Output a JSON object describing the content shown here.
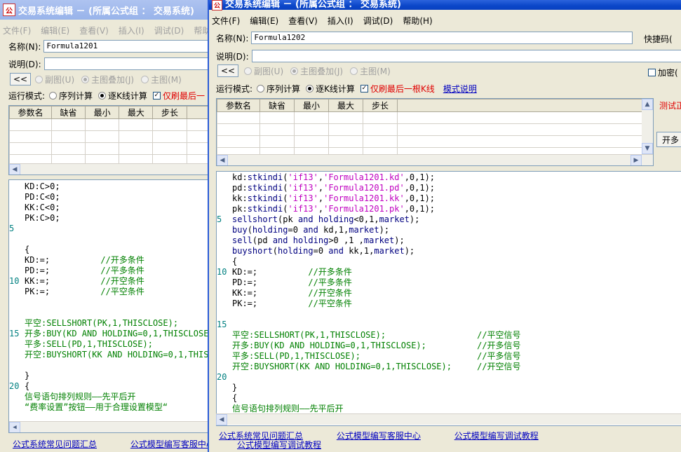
{
  "winA": {
    "title": "交易系统编辑 － (所属公式组 ： 交易系统)",
    "menu": [
      "文件(F)",
      "编辑(E)",
      "查看(V)",
      "插入(I)",
      "调试(D)",
      "帮助"
    ],
    "name_label": "名称(N):",
    "name_value": "Formula1201",
    "desc_label": "说明(D):",
    "desc_value": "",
    "collapse_btn": "<<",
    "chart_opts": [
      "副图(U)",
      "主图叠加(J)",
      "主图(M)"
    ],
    "run_label": "运行模式:",
    "run_seq": "序列计算",
    "run_k": "逐K线计算",
    "refresh_label": "仅刷最后一",
    "param_headers": [
      "参数名",
      "缺省",
      "最小",
      "最大",
      "步长"
    ],
    "code_lines": [
      {
        "n": "",
        "t": "KD:C>0;"
      },
      {
        "n": "",
        "t": "PD:C<0;"
      },
      {
        "n": "",
        "t": "KK:C<0;"
      },
      {
        "n": "",
        "t": "PK:C>0;"
      },
      {
        "n": "5",
        "t": ""
      },
      {
        "n": "",
        "t": ""
      },
      {
        "n": "",
        "t": "{"
      },
      {
        "n": "",
        "t": "KD:=;          //开多条件"
      },
      {
        "n": "",
        "t": "PD:=;          //平多条件"
      },
      {
        "n": "10",
        "t": "KK:=;          //开空条件"
      },
      {
        "n": "",
        "t": "PK:=;          //平空条件"
      },
      {
        "n": "",
        "t": ""
      },
      {
        "n": "",
        "t": ""
      },
      {
        "n": "",
        "t": "平空:SELLSHORT(PK,1,THISCLOSE);"
      },
      {
        "n": "15",
        "t": "开多:BUY(KD AND HOLDING=0,1,THISCLOSE)"
      },
      {
        "n": "",
        "t": "平多:SELL(PD,1,THISCLOSE);"
      },
      {
        "n": "",
        "t": "开空:BUYSHORT(KK AND HOLDING=0,1,THISC"
      },
      {
        "n": "",
        "t": ""
      },
      {
        "n": "",
        "t": "}"
      },
      {
        "n": "20",
        "t": "{"
      },
      {
        "n": "",
        "t": "信号语句排列规则——先平后开"
      },
      {
        "n": "",
        "t": "“费率设置”按钮——用于合理设置模型“"
      }
    ],
    "links": [
      "公式系统常见问题汇总",
      "公式模型编写客服中心"
    ]
  },
  "winB": {
    "title": "交易系统编辑 － (所属公式组 ： 交易系统)",
    "menu": [
      "文件(F)",
      "编辑(E)",
      "查看(V)",
      "插入(I)",
      "调试(D)",
      "帮助(H)"
    ],
    "name_label": "名称(N):",
    "name_value": "Formula1202",
    "shortcut_label": "快捷码(",
    "desc_label": "说明(D):",
    "desc_value": "",
    "collapse_btn": "<<",
    "chart_opts": [
      "副图(U)",
      "主图叠加(J)",
      "主图(M)"
    ],
    "encrypt_label": "加密(",
    "run_label": "运行模式:",
    "run_seq": "序列计算",
    "run_k": "逐K线计算",
    "refresh_label": "仅刷最后一根K线",
    "mode_link": "模式说明",
    "test_label": "测试正",
    "open_btn": "开多",
    "param_headers": [
      "参数名",
      "缺省",
      "最小",
      "最大",
      "步长"
    ],
    "code_lines": [
      {
        "n": "",
        "t": "kd:stkindi('if13','Formula1201.kd',0,1);"
      },
      {
        "n": "",
        "t": "pd:stkindi('if13','Formula1201.pd',0,1);"
      },
      {
        "n": "",
        "t": "kk:stkindi('if13','Formula1201.kk',0,1);"
      },
      {
        "n": "",
        "t": "pk:stkindi('if13','Formula1201.pk',0,1);"
      },
      {
        "n": "5",
        "t": "sellshort(pk and holding<0,1,market);"
      },
      {
        "n": "",
        "t": "buy(holding=0 and kd,1,market);"
      },
      {
        "n": "",
        "t": "sell(pd and holding>0 ,1 ,market);"
      },
      {
        "n": "",
        "t": "buyshort(holding=0 and kk,1,market);"
      },
      {
        "n": "",
        "t": "{"
      },
      {
        "n": "10",
        "t": "KD:=;          //开多条件"
      },
      {
        "n": "",
        "t": "PD:=;          //平多条件"
      },
      {
        "n": "",
        "t": "KK:=;          //开空条件"
      },
      {
        "n": "",
        "t": "PK:=;          //平空条件"
      },
      {
        "n": "",
        "t": ""
      },
      {
        "n": "15",
        "t": ""
      },
      {
        "n": "",
        "t": "平空:SELLSHORT(PK,1,THISCLOSE);                  //平空信号"
      },
      {
        "n": "",
        "t": "开多:BUY(KD AND HOLDING=0,1,THISCLOSE);          //开多信号"
      },
      {
        "n": "",
        "t": "平多:SELL(PD,1,THISCLOSE);                       //平多信号"
      },
      {
        "n": "",
        "t": "开空:BUYSHORT(KK AND HOLDING=0,1,THISCLOSE);     //开空信号"
      },
      {
        "n": "20",
        "t": ""
      },
      {
        "n": "",
        "t": "}"
      },
      {
        "n": "",
        "t": "{"
      },
      {
        "n": "",
        "t": "信号语句排列规则——先平后开"
      }
    ],
    "links": [
      "公式系统常见问题汇总",
      "公式模型编写客服中心",
      "公式模型编写调试教程"
    ],
    "links_under": "公式模型编写调试教程"
  }
}
